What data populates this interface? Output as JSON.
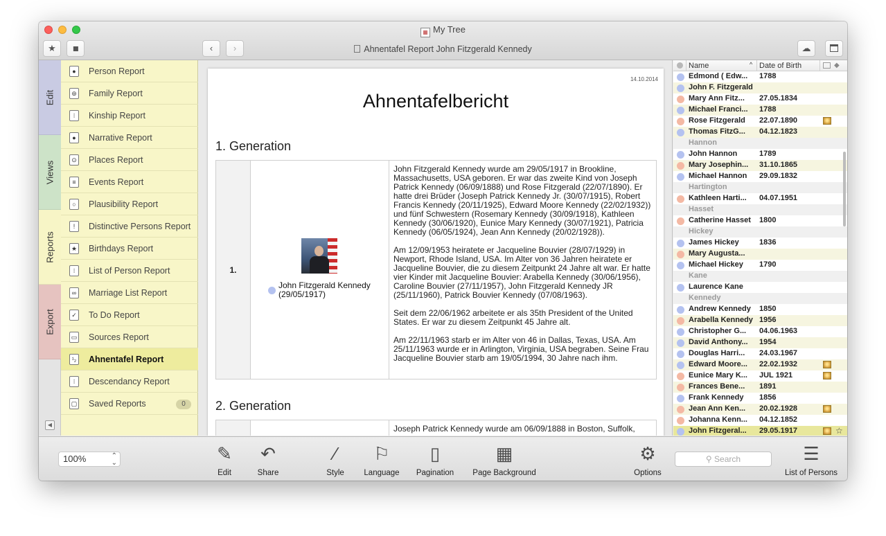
{
  "window": {
    "title": "My Tree",
    "nav_title": "Ahnentafel Report John Fitzgerald Kennedy"
  },
  "toolbar": {
    "favorites_icon": "star-icon",
    "tag_icon": "tag-icon",
    "back_icon": "chevron-left-icon",
    "forward_icon": "chevron-right-icon",
    "cloud_icon": "cloud-icon",
    "sidebar_icon": "sidebar-icon"
  },
  "tabs": [
    {
      "label": "Edit",
      "color": "#c9cbe3"
    },
    {
      "label": "Views",
      "color": "#cde3c8"
    },
    {
      "label": "Reports",
      "color": "#f7f5c6"
    },
    {
      "label": "Export",
      "color": "#e6c3c0"
    }
  ],
  "reports": [
    {
      "label": "Person Report",
      "icon": "person-icon"
    },
    {
      "label": "Family Report",
      "icon": "family-icon"
    },
    {
      "label": "Kinship Report",
      "icon": "kinship-icon"
    },
    {
      "label": "Narrative Report",
      "icon": "speech-bubble-icon"
    },
    {
      "label": "Places Report",
      "icon": "map-pin-icon"
    },
    {
      "label": "Events Report",
      "icon": "list-icon"
    },
    {
      "label": "Plausibility Report",
      "icon": "magnifier-icon"
    },
    {
      "label": "Distinctive Persons Report",
      "icon": "exclamation-icon"
    },
    {
      "label": "Birthdays Report",
      "icon": "star-icon"
    },
    {
      "label": "List of Person Report",
      "icon": "person-list-icon"
    },
    {
      "label": "Marriage List Report",
      "icon": "rings-icon"
    },
    {
      "label": "To Do Report",
      "icon": "checkbox-icon"
    },
    {
      "label": "Sources Report",
      "icon": "source-icon"
    },
    {
      "label": "Ahnentafel Report",
      "icon": "ahnentafel-icon"
    },
    {
      "label": "Descendancy Report",
      "icon": "descendancy-icon"
    },
    {
      "label": "Saved Reports",
      "icon": "saved-reports-icon",
      "badge": "0"
    }
  ],
  "document": {
    "date": "14.10.2014",
    "title": "Ahnentafelbericht",
    "gen1": {
      "heading": "1. Generation",
      "number": "1.",
      "person_name": "John Fitzgerald Kennedy",
      "person_dates": "(29/05/1917)",
      "p1": "John Fitzgerald Kennedy wurde am 29/05/1917 in Brookline, Massachusetts, USA geboren. Er war das zweite Kind von Joseph Patrick Kennedy (06/09/1888) und Rose Fitzgerald (22/07/1890). Er hatte drei Brüder (Joseph Patrick Kennedy Jr. (30/07/1915), Robert Francis Kennedy (20/11/1925), Edward Moore Kennedy (22/02/1932)) und fünf Schwestern (Rosemary Kennedy (30/09/1918), Kathleen Kennedy (30/06/1920), Eunice Mary Kennedy (30/07/1921), Patricia Kennedy (06/05/1924), Jean Ann Kennedy (20/02/1928)).",
      "p2": "Am 12/09/1953 heiratete er Jacqueline Bouvier (28/07/1929) in Newport, Rhode Island, USA. Im Alter von 36 Jahren heiratete er Jacqueline Bouvier, die zu diesem Zeitpunkt 24 Jahre alt war. Er hatte vier Kinder mit Jacqueline Bouvier: Arabella Kennedy (30/06/1956), Caroline Bouvier (27/11/1957), John Fitzgerald Kennedy JR (25/11/1960), Patrick Bouvier Kennedy (07/08/1963).",
      "p3": "Seit dem 22/06/1962 arbeitete er als 35th President of the United States. Er war zu diesem Zeitpunkt 45 Jahre alt.",
      "p4": "Am 22/11/1963 starb er im Alter von 46 in Dallas, Texas, USA. Am 25/11/1963 wurde er in Arlington, Virginia, USA begraben. Seine Frau Jacqueline Bouvier starb am 19/05/1994, 30 Jahre nach ihm."
    },
    "gen2": {
      "heading": "2. Generation",
      "p1": "Joseph Patrick Kennedy wurde am 06/09/1888 in Boston, Suffolk,"
    }
  },
  "person_list": {
    "col_name": "Name",
    "col_sort": "^",
    "col_birth": "Date of Birth",
    "rows": [
      {
        "kind": "person",
        "name": "Edmond ( Edw...",
        "date": "1788",
        "sex": "m"
      },
      {
        "kind": "person",
        "name": "John F. Fitzgerald",
        "date": "",
        "sex": "m"
      },
      {
        "kind": "person",
        "name": "Mary Ann Fitz...",
        "date": "27.05.1834",
        "sex": "f"
      },
      {
        "kind": "person",
        "name": "Michael Franci...",
        "date": "1788",
        "sex": "m"
      },
      {
        "kind": "person",
        "name": "Rose Fitzgerald",
        "date": "22.07.1890",
        "sex": "f",
        "photo": true
      },
      {
        "kind": "person",
        "name": "Thomas FitzG...",
        "date": "04.12.1823",
        "sex": "m"
      },
      {
        "kind": "group",
        "name": "Hannon"
      },
      {
        "kind": "person",
        "name": "John Hannon",
        "date": "1789",
        "sex": "m"
      },
      {
        "kind": "person",
        "name": "Mary Josephin...",
        "date": "31.10.1865",
        "sex": "f"
      },
      {
        "kind": "person",
        "name": "Michael Hannon",
        "date": "29.09.1832",
        "sex": "m"
      },
      {
        "kind": "group",
        "name": "Hartington"
      },
      {
        "kind": "person",
        "name": "Kathleen Harti...",
        "date": "04.07.1951",
        "sex": "f"
      },
      {
        "kind": "group",
        "name": "Hasset"
      },
      {
        "kind": "person",
        "name": "Catherine Hasset",
        "date": "1800",
        "sex": "f"
      },
      {
        "kind": "group",
        "name": "Hickey"
      },
      {
        "kind": "person",
        "name": "James Hickey",
        "date": "1836",
        "sex": "m"
      },
      {
        "kind": "person",
        "name": "Mary Augusta...",
        "date": "",
        "sex": "f"
      },
      {
        "kind": "person",
        "name": "Michael Hickey",
        "date": "1790",
        "sex": "m"
      },
      {
        "kind": "group",
        "name": "Kane"
      },
      {
        "kind": "person",
        "name": "Laurence Kane",
        "date": "",
        "sex": "m"
      },
      {
        "kind": "group",
        "name": "Kennedy"
      },
      {
        "kind": "person",
        "name": "Andrew Kennedy",
        "date": "1850",
        "sex": "m"
      },
      {
        "kind": "person",
        "name": "Arabella Kennedy",
        "date": "1956",
        "sex": "f"
      },
      {
        "kind": "person",
        "name": "Christopher G...",
        "date": "04.06.1963",
        "sex": "m"
      },
      {
        "kind": "person",
        "name": "David Anthony...",
        "date": "1954",
        "sex": "m"
      },
      {
        "kind": "person",
        "name": "Douglas Harri...",
        "date": "24.03.1967",
        "sex": "m"
      },
      {
        "kind": "person",
        "name": "Edward Moore...",
        "date": "22.02.1932",
        "sex": "m",
        "photo": true
      },
      {
        "kind": "person",
        "name": "Eunice Mary K...",
        "date": "JUL 1921",
        "sex": "f",
        "photo": true
      },
      {
        "kind": "person",
        "name": "Frances Bene...",
        "date": "1891",
        "sex": "f"
      },
      {
        "kind": "person",
        "name": "Frank Kennedy",
        "date": "1856",
        "sex": "m"
      },
      {
        "kind": "person",
        "name": "Jean Ann Ken...",
        "date": "20.02.1928",
        "sex": "f",
        "photo": true
      },
      {
        "kind": "person",
        "name": "Johanna Kenn...",
        "date": "04.12.1852",
        "sex": "f"
      },
      {
        "kind": "person",
        "name": "John Fitzgeral...",
        "date": "29.05.1917",
        "sex": "m",
        "photo": true,
        "star": true,
        "selected": true
      }
    ]
  },
  "colors": {
    "male": "#b4c2f0",
    "female": "#f4b9a4",
    "selection": "#e8e79c",
    "reports_bg": "#f8f6c8"
  },
  "bottom": {
    "zoom": "100%",
    "tools": [
      {
        "label": "Edit",
        "icon": "pencil-icon"
      },
      {
        "label": "Share",
        "icon": "share-arrow-icon"
      },
      {
        "label": "Style",
        "icon": "magic-wand-icon"
      },
      {
        "label": "Language",
        "icon": "flag-icon"
      },
      {
        "label": "Pagination",
        "icon": "page-icon"
      },
      {
        "label": "Page Background",
        "icon": "page-background-icon"
      },
      {
        "label": "Options",
        "icon": "gear-icon"
      },
      {
        "label": "List of Persons",
        "icon": "list-of-persons-icon"
      }
    ],
    "search_placeholder": "Search"
  }
}
